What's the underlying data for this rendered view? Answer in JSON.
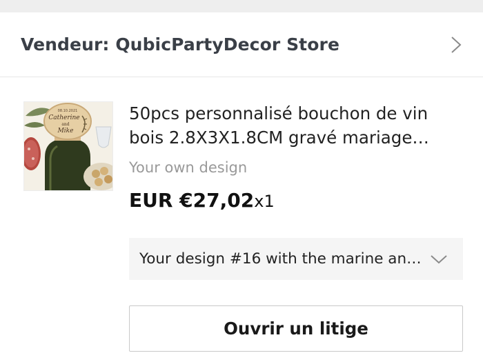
{
  "seller": {
    "label": "Vendeur: QubicPartyDecor Store",
    "chevron_icon": "chevron-right-icon"
  },
  "item": {
    "image_icon": "product-thumbnail-wine-cork",
    "image_engraving": "08.10.2021 Catherine and Mike",
    "title": "50pcs personnalisé bouchon de vin bois 2.8X3X1.8CM gravé mariage anni...",
    "variant": "Your own design",
    "price": "EUR €27,02",
    "quantity": "x1"
  },
  "design_select": {
    "value": "Your design #16 with the marine ankl...",
    "chevron_icon": "chevron-down-icon"
  },
  "actions": {
    "open_dispute_label": "Ouvrir un litige"
  },
  "colors": {
    "muted_text": "#999999",
    "select_bg": "#f5f5f5",
    "border": "#c8c8c8",
    "divider": "#e6e6e6"
  }
}
